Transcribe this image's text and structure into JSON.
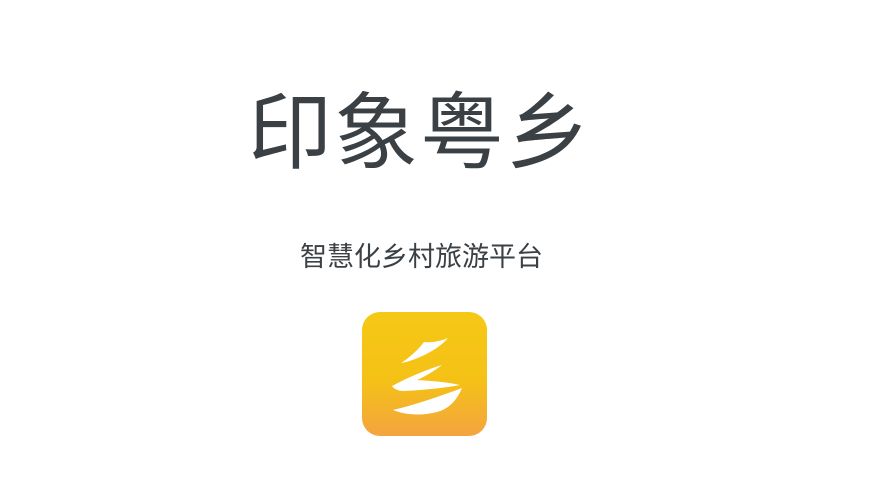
{
  "app": {
    "title": "印象粤乡",
    "tagline": "智慧化乡村旅游平台"
  },
  "logo": {
    "icon": "xiang-character-logo-icon",
    "gradient_top": "#f5c816",
    "gradient_bottom": "#f3a440",
    "glyph_color": "#ffffff"
  }
}
